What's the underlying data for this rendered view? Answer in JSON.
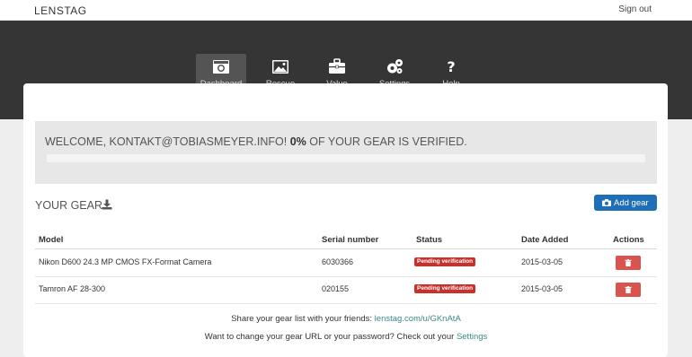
{
  "header": {
    "brand": "LENSTAG",
    "sign_out": "Sign out"
  },
  "nav": {
    "items": [
      {
        "label": "Dashboard",
        "icon": "camera-icon",
        "active": true
      },
      {
        "label": "Rescue",
        "icon": "image-icon",
        "active": false
      },
      {
        "label": "Value",
        "icon": "briefcase-icon",
        "active": false
      },
      {
        "label": "Settings",
        "icon": "gears-icon",
        "active": false
      },
      {
        "label": "Help",
        "icon": "question-icon",
        "active": false
      }
    ]
  },
  "welcome": {
    "prefix": "WELCOME, KONTAKT@TOBIASMEYER.INFO! ",
    "percent": "0%",
    "suffix": " OF YOUR GEAR IS VERIFIED.",
    "progress_fraction": 0
  },
  "gear": {
    "title": "YOUR GEAR",
    "add_label": "Add gear",
    "columns": [
      "Model",
      "Serial number",
      "Status",
      "Date Added",
      "Actions"
    ],
    "rows": [
      {
        "model": "Nikon D600 24.3 MP CMOS FX-Format Camera",
        "serial": "6030366",
        "status": "Pending verification",
        "date": "2015-03-05"
      },
      {
        "model": "Tamron AF 28-300",
        "serial": "020155",
        "status": "Pending verification",
        "date": "2015-03-05"
      }
    ]
  },
  "footer": {
    "share_text": "Share your gear list with your friends: ",
    "share_link": "lenstag.com/u/GKnAtA",
    "settings_text": "Want to change your gear URL or your password? Check out your ",
    "settings_link": "Settings"
  },
  "colors": {
    "nav_bg": "#353535",
    "primary": "#1f6fb8",
    "danger": "#d9534f",
    "status_badge": "#c9302c",
    "link": "#3a8a8a"
  }
}
